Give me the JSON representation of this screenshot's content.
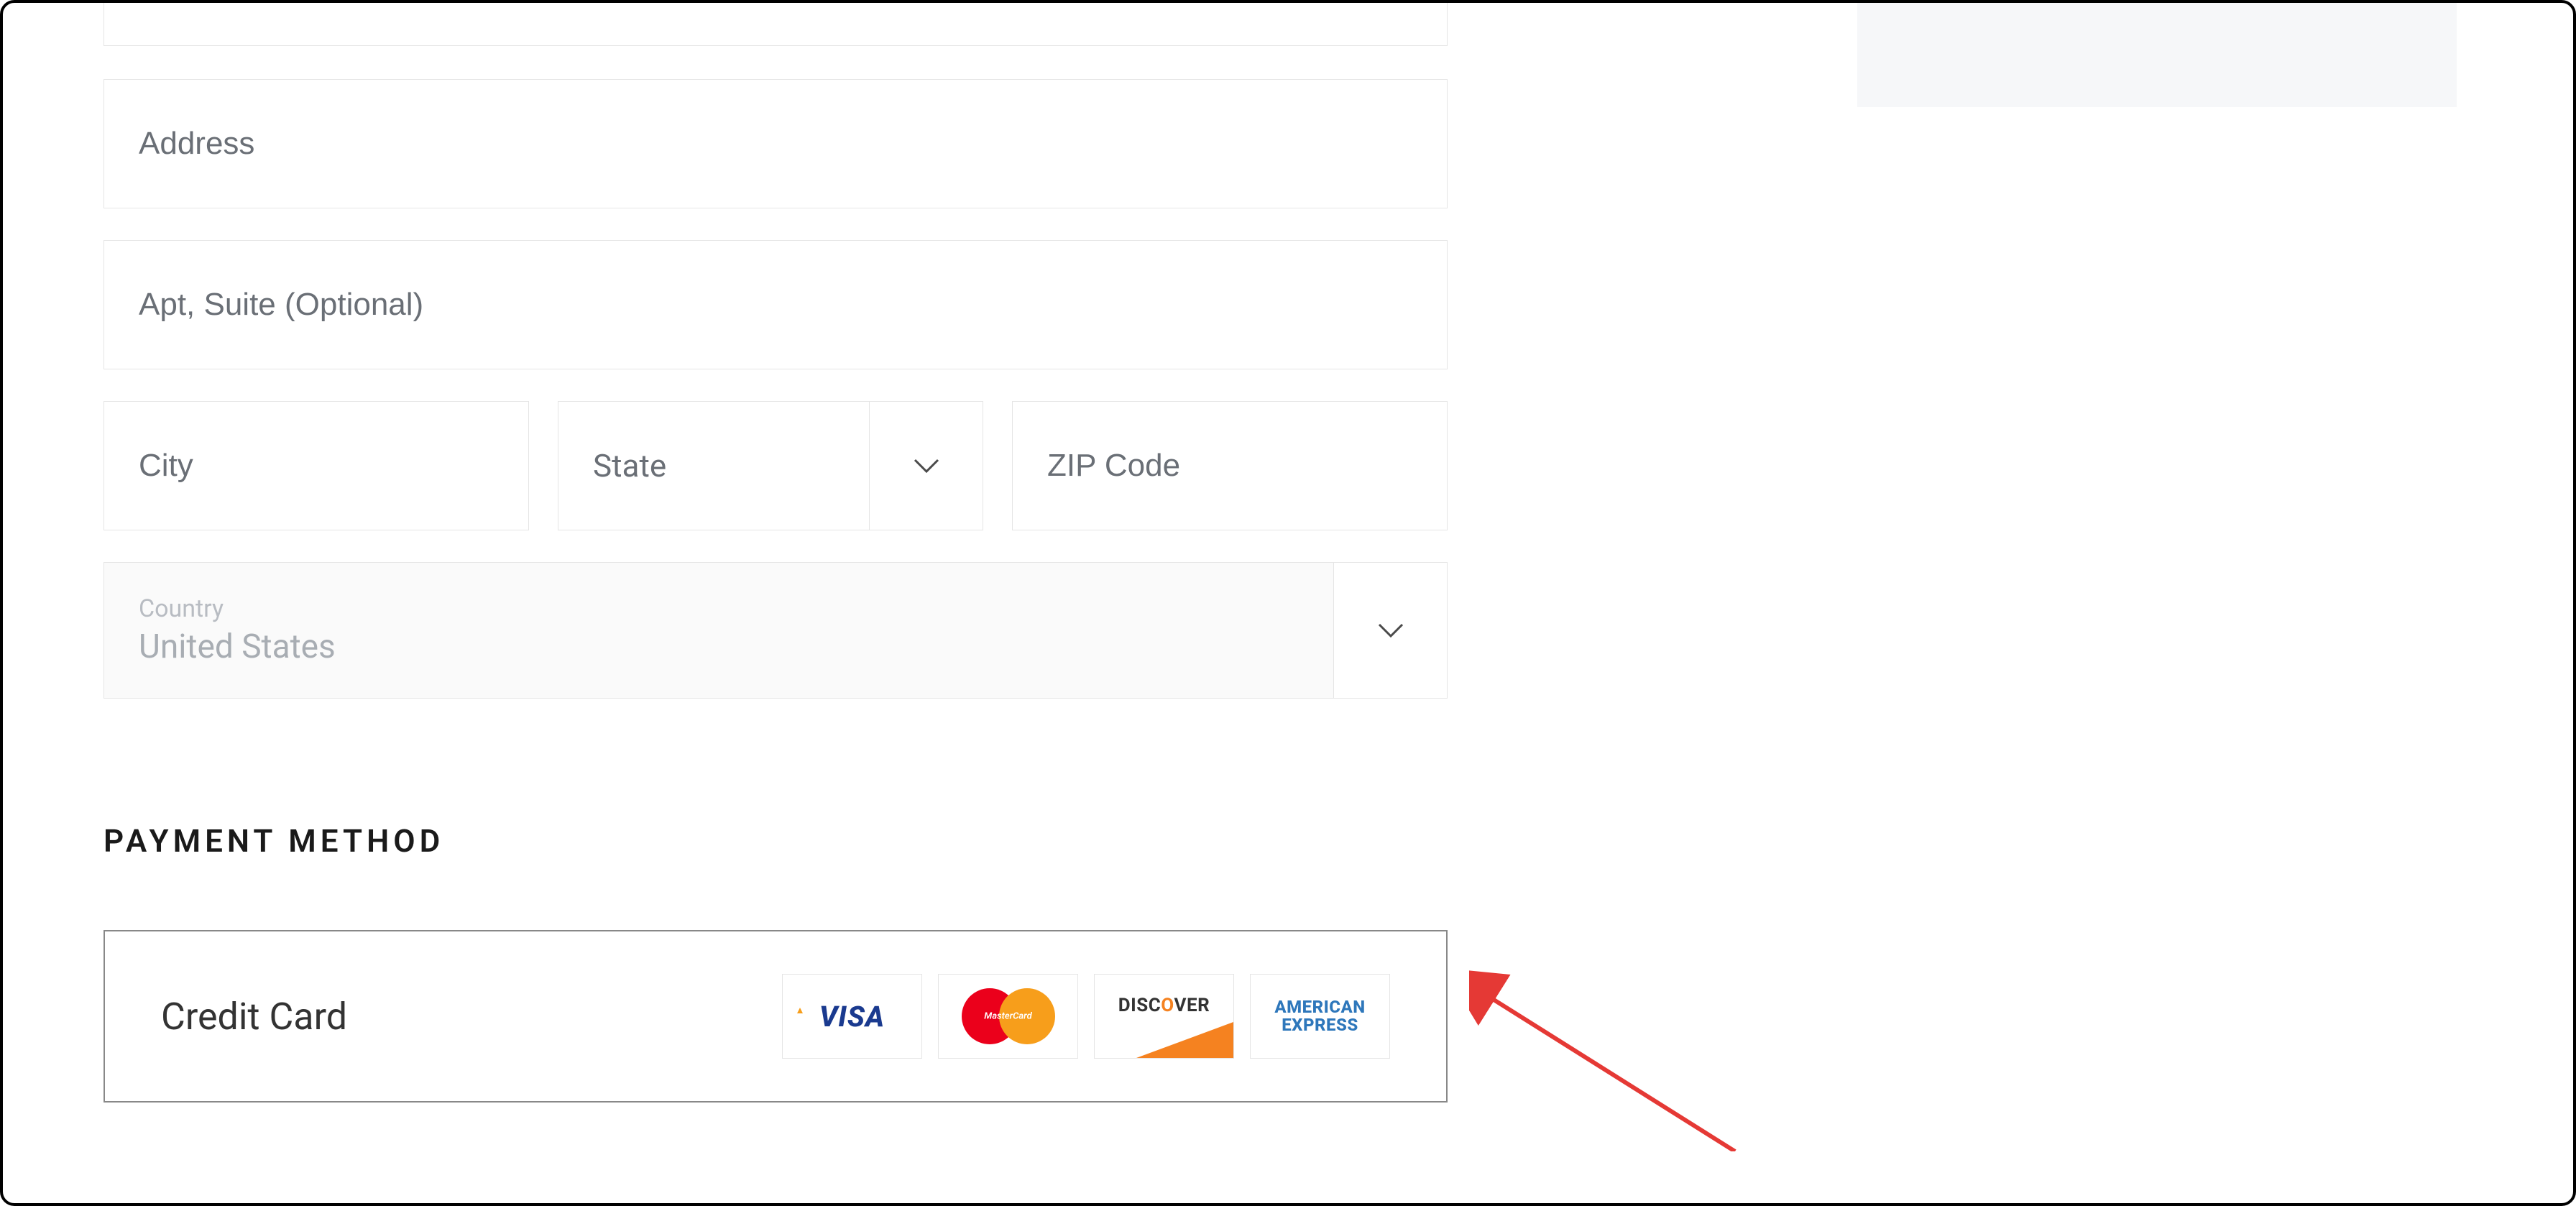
{
  "form": {
    "address_placeholder": "Address",
    "apt_placeholder": "Apt, Suite (Optional)",
    "city_placeholder": "City",
    "state_placeholder": "State",
    "zip_placeholder": "ZIP Code",
    "country_label": "Country",
    "country_value": "United States"
  },
  "payment": {
    "section_heading": "PAYMENT METHOD",
    "option_label": "Credit Card",
    "cards": {
      "visa": "VISA",
      "mastercard": "MasterCard",
      "discover": "DISCOVER",
      "amex_line1": "AMERICAN",
      "amex_line2": "EXPRESS"
    }
  }
}
